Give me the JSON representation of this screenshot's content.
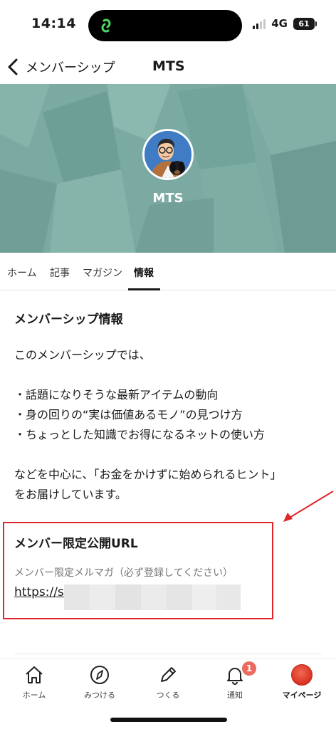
{
  "status_bar": {
    "time": "14:14",
    "network": "4G",
    "battery": "61"
  },
  "header": {
    "back_label": "メンバーシップ",
    "title": "MTS"
  },
  "cover": {
    "creator_name": "MTS",
    "background_color": "#7aaaa1"
  },
  "tabs": [
    {
      "label": "ホーム",
      "active": false
    },
    {
      "label": "記事",
      "active": false
    },
    {
      "label": "マガジン",
      "active": false
    },
    {
      "label": "情報",
      "active": true
    }
  ],
  "info": {
    "section_title": "メンバーシップ情報",
    "intro": "このメンバーシップでは、",
    "bullets": [
      "・話題になりそうな最新アイテムの動向",
      "・身の回りの“実は価値あるモノ”の見つけ方",
      "・ちょっとした知識でお得になるネットの使い方"
    ],
    "closing_line1": "などを中心に、「お金をかけずに始められるヒント」",
    "closing_line2": "をお届けしています。"
  },
  "limited_url": {
    "title": "メンバー限定公開URL",
    "caption": "メンバー限定メルマガ（必ず登録してください）",
    "link_visible": "https://s",
    "highlight_color": "#e0262b"
  },
  "tabbar": {
    "items": [
      {
        "label": "ホーム",
        "icon": "home-icon"
      },
      {
        "label": "みつける",
        "icon": "compass-icon"
      },
      {
        "label": "つくる",
        "icon": "pencil-icon"
      },
      {
        "label": "通知",
        "icon": "bell-icon",
        "badge": "1"
      },
      {
        "label": "マイページ",
        "icon": "avatar",
        "active": true
      }
    ]
  }
}
